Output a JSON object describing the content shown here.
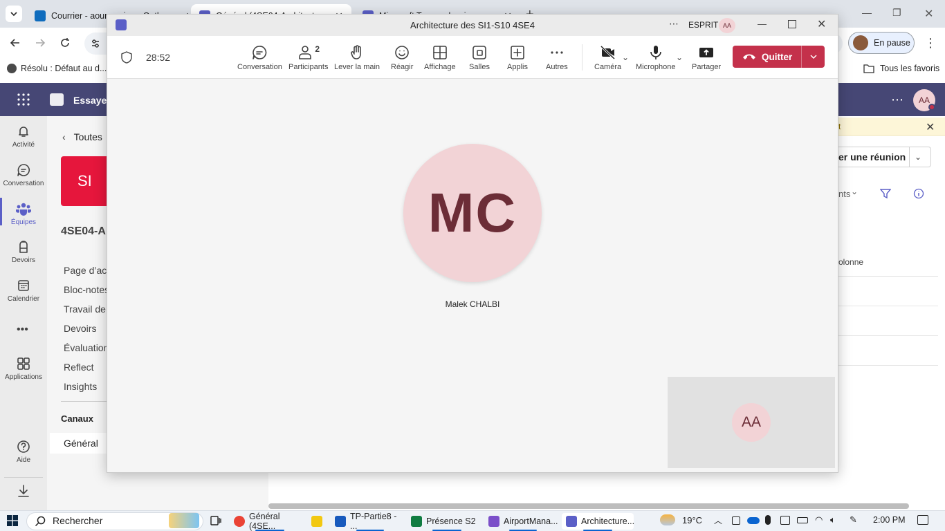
{
  "browser": {
    "tabs": [
      {
        "title": "Courrier - aoun amina - Outlo...",
        "icon_color": "#0f6cbd",
        "icon": "outlook-icon"
      },
      {
        "title": "Général (4SE04-Architecture de...",
        "icon_color": "#5b5fc7",
        "icon": "teams-icon"
      },
      {
        "title": "Microsoft Teams classic",
        "icon_color": "#5b5fc7",
        "icon": "teams-icon"
      }
    ],
    "pause_label": "En pause",
    "bookmark_left": "Résolu : Défaut au d...",
    "bookmark_right": "Tous les favoris"
  },
  "teams": {
    "header_trial": "Essayez",
    "header_avatar": "AA",
    "rail": [
      {
        "label": "Activité",
        "icon": "bell-icon"
      },
      {
        "label": "Conversation",
        "icon": "chat-icon"
      },
      {
        "label": "Équipes",
        "icon": "teams-people-icon"
      },
      {
        "label": "Devoirs",
        "icon": "backpack-icon"
      },
      {
        "label": "Calendrier",
        "icon": "calendar-icon"
      },
      {
        "label": "Applications",
        "icon": "apps-icon"
      },
      {
        "label": "Aide",
        "icon": "help-icon"
      }
    ],
    "back_label": "Toutes",
    "team_tile": "SI",
    "team_name": "4SE04-A",
    "nav": [
      "Page d’acc",
      "Bloc-notes",
      "Travail de",
      "Devoirs",
      "Évaluation",
      "Reflect",
      "Insights"
    ],
    "channels_heading": "Canaux",
    "channel_general": "Général",
    "banner_text": "t",
    "meeting_btn": "er une réunion",
    "filter_text": "nts",
    "column_text": "olonne"
  },
  "meeting": {
    "title": "Architecture des SI1-S10 4SE4",
    "org": "ESPRIT",
    "org_avatar": "AA",
    "timer": "28:52",
    "participants_count": "2",
    "tools": [
      {
        "label": "Conversation",
        "icon": "chat-icon"
      },
      {
        "label": "Participants",
        "icon": "people-icon"
      },
      {
        "label": "Lever la main",
        "icon": "raise-hand-icon"
      },
      {
        "label": "Réagir",
        "icon": "smiley-icon"
      },
      {
        "label": "Affichage",
        "icon": "grid-icon"
      },
      {
        "label": "Salles",
        "icon": "rooms-icon"
      },
      {
        "label": "Applis",
        "icon": "add-app-icon"
      },
      {
        "label": "Autres",
        "icon": "more-icon"
      },
      {
        "label": "Caméra",
        "icon": "camera-off-icon"
      },
      {
        "label": "Microphone",
        "icon": "microphone-icon"
      },
      {
        "label": "Partager",
        "icon": "share-icon"
      }
    ],
    "quit_label": "Quitter",
    "speaker_initials": "MC",
    "speaker_name": "Malek CHALBI",
    "self_initials": "AA"
  },
  "taskbar": {
    "search": "Rechercher",
    "apps": [
      {
        "label": "Général (4SE...",
        "color": "#ea4335"
      },
      {
        "label": "",
        "color": "#f2c811"
      },
      {
        "label": "TP-Partie8 - ...",
        "color": "#185abd"
      },
      {
        "label": "Présence S2",
        "color": "#107c41"
      },
      {
        "label": "AirportMana...",
        "color": "#7b4fc9"
      },
      {
        "label": "Architecture...",
        "color": "#5b5fc7"
      }
    ],
    "weather": "19°C",
    "time": "2:00 PM"
  }
}
